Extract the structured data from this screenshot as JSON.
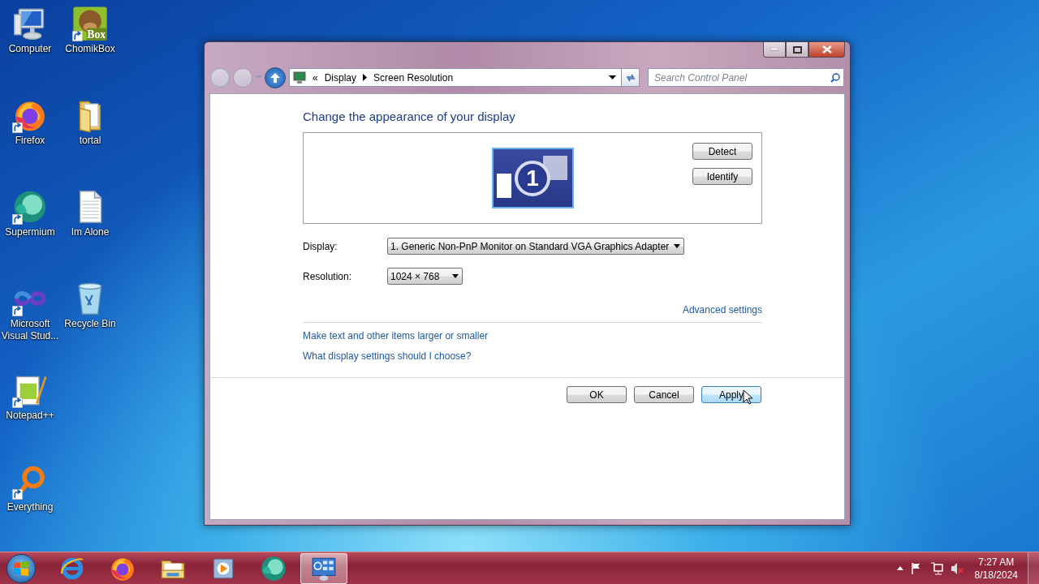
{
  "desktop_icons": [
    {
      "label": "Computer",
      "kind": "computer",
      "shortcut": false
    },
    {
      "label": "Firefox",
      "kind": "firefox",
      "shortcut": true
    },
    {
      "label": "Supermium",
      "kind": "supermium",
      "shortcut": true
    },
    {
      "label": "Microsoft Visual Stud...",
      "kind": "visualstudio",
      "shortcut": true
    },
    {
      "label": "Notepad++",
      "kind": "notepad",
      "shortcut": true
    },
    {
      "label": "Everything",
      "kind": "everything",
      "shortcut": true
    },
    {
      "label": "ChomikBox",
      "kind": "chomikbox",
      "shortcut": true,
      "badge": "Box"
    },
    {
      "label": "tortal",
      "kind": "folder",
      "shortcut": false
    },
    {
      "label": "Im Alone",
      "kind": "document",
      "shortcut": false
    },
    {
      "label": "Recycle Bin",
      "kind": "recycle-bin",
      "shortcut": false
    }
  ],
  "window": {
    "nav": {
      "back_disabled": true,
      "forward_disabled": true
    },
    "address": {
      "prefix": "«",
      "crumbs": [
        "Display",
        "Screen Resolution"
      ]
    },
    "search": {
      "placeholder": "Search Control Panel"
    },
    "heading": "Change the appearance of your display",
    "preview": {
      "monitor_number": "1",
      "buttons": [
        "Detect",
        "Identify"
      ]
    },
    "fields": [
      {
        "label": "Display:",
        "value": "1. Generic Non-PnP Monitor on Standard VGA Graphics Adapter"
      },
      {
        "label": "Resolution:",
        "value": "1024 × 768"
      }
    ],
    "advanced_link": "Advanced settings",
    "links": [
      "Make text and other items larger or smaller",
      "What display settings should I choose?"
    ],
    "buttons": [
      {
        "label": "OK",
        "default": false
      },
      {
        "label": "Cancel",
        "default": false
      },
      {
        "label": "Apply",
        "default": true
      }
    ]
  },
  "taskbar": {
    "items": [
      {
        "kind": "ie",
        "selected": false
      },
      {
        "kind": "firefox",
        "selected": false
      },
      {
        "kind": "explorer",
        "selected": false
      },
      {
        "kind": "media-player",
        "selected": false
      },
      {
        "kind": "supermium",
        "selected": false
      },
      {
        "kind": "control-panel",
        "selected": true
      }
    ],
    "tray": [
      {
        "kind": "show-hidden"
      },
      {
        "kind": "flag"
      },
      {
        "kind": "network"
      },
      {
        "kind": "volume",
        "muted": true
      }
    ],
    "time": "7:27 AM",
    "date": "8/18/2024"
  }
}
